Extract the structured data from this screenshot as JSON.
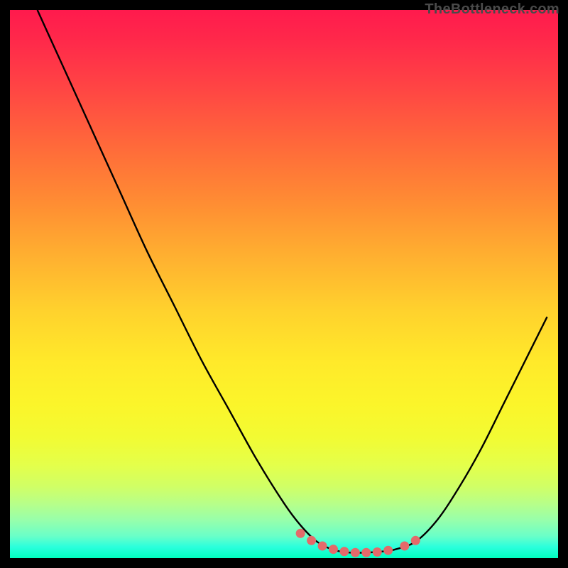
{
  "attribution": "TheBottleneck.com",
  "chart_data": {
    "type": "line",
    "title": "",
    "xlabel": "",
    "ylabel": "",
    "xlim": [
      0,
      100
    ],
    "ylim": [
      0,
      100
    ],
    "series": [
      {
        "name": "curve",
        "x": [
          5,
          10,
          15,
          20,
          25,
          30,
          35,
          40,
          45,
          50,
          53,
          56,
          59,
          62,
          65,
          68,
          70,
          74,
          78,
          82,
          86,
          90,
          94,
          98
        ],
        "y": [
          100,
          89,
          78,
          67,
          56,
          46,
          36,
          27,
          18,
          10,
          6,
          3,
          1.5,
          1,
          1,
          1.2,
          1.5,
          3,
          7,
          13,
          20,
          28,
          36,
          44
        ]
      }
    ],
    "markers": {
      "name": "highlight",
      "x": [
        53,
        55,
        57,
        59,
        61,
        63,
        65,
        67,
        69,
        72,
        74
      ],
      "y": [
        4.5,
        3.2,
        2.2,
        1.6,
        1.2,
        1.0,
        1.0,
        1.1,
        1.4,
        2.2,
        3.2
      ]
    },
    "colors": {
      "curve": "#000000",
      "marker": "#e46a6a",
      "gradient_top": "#ff1a4d",
      "gradient_bottom": "#00ffc0"
    }
  }
}
